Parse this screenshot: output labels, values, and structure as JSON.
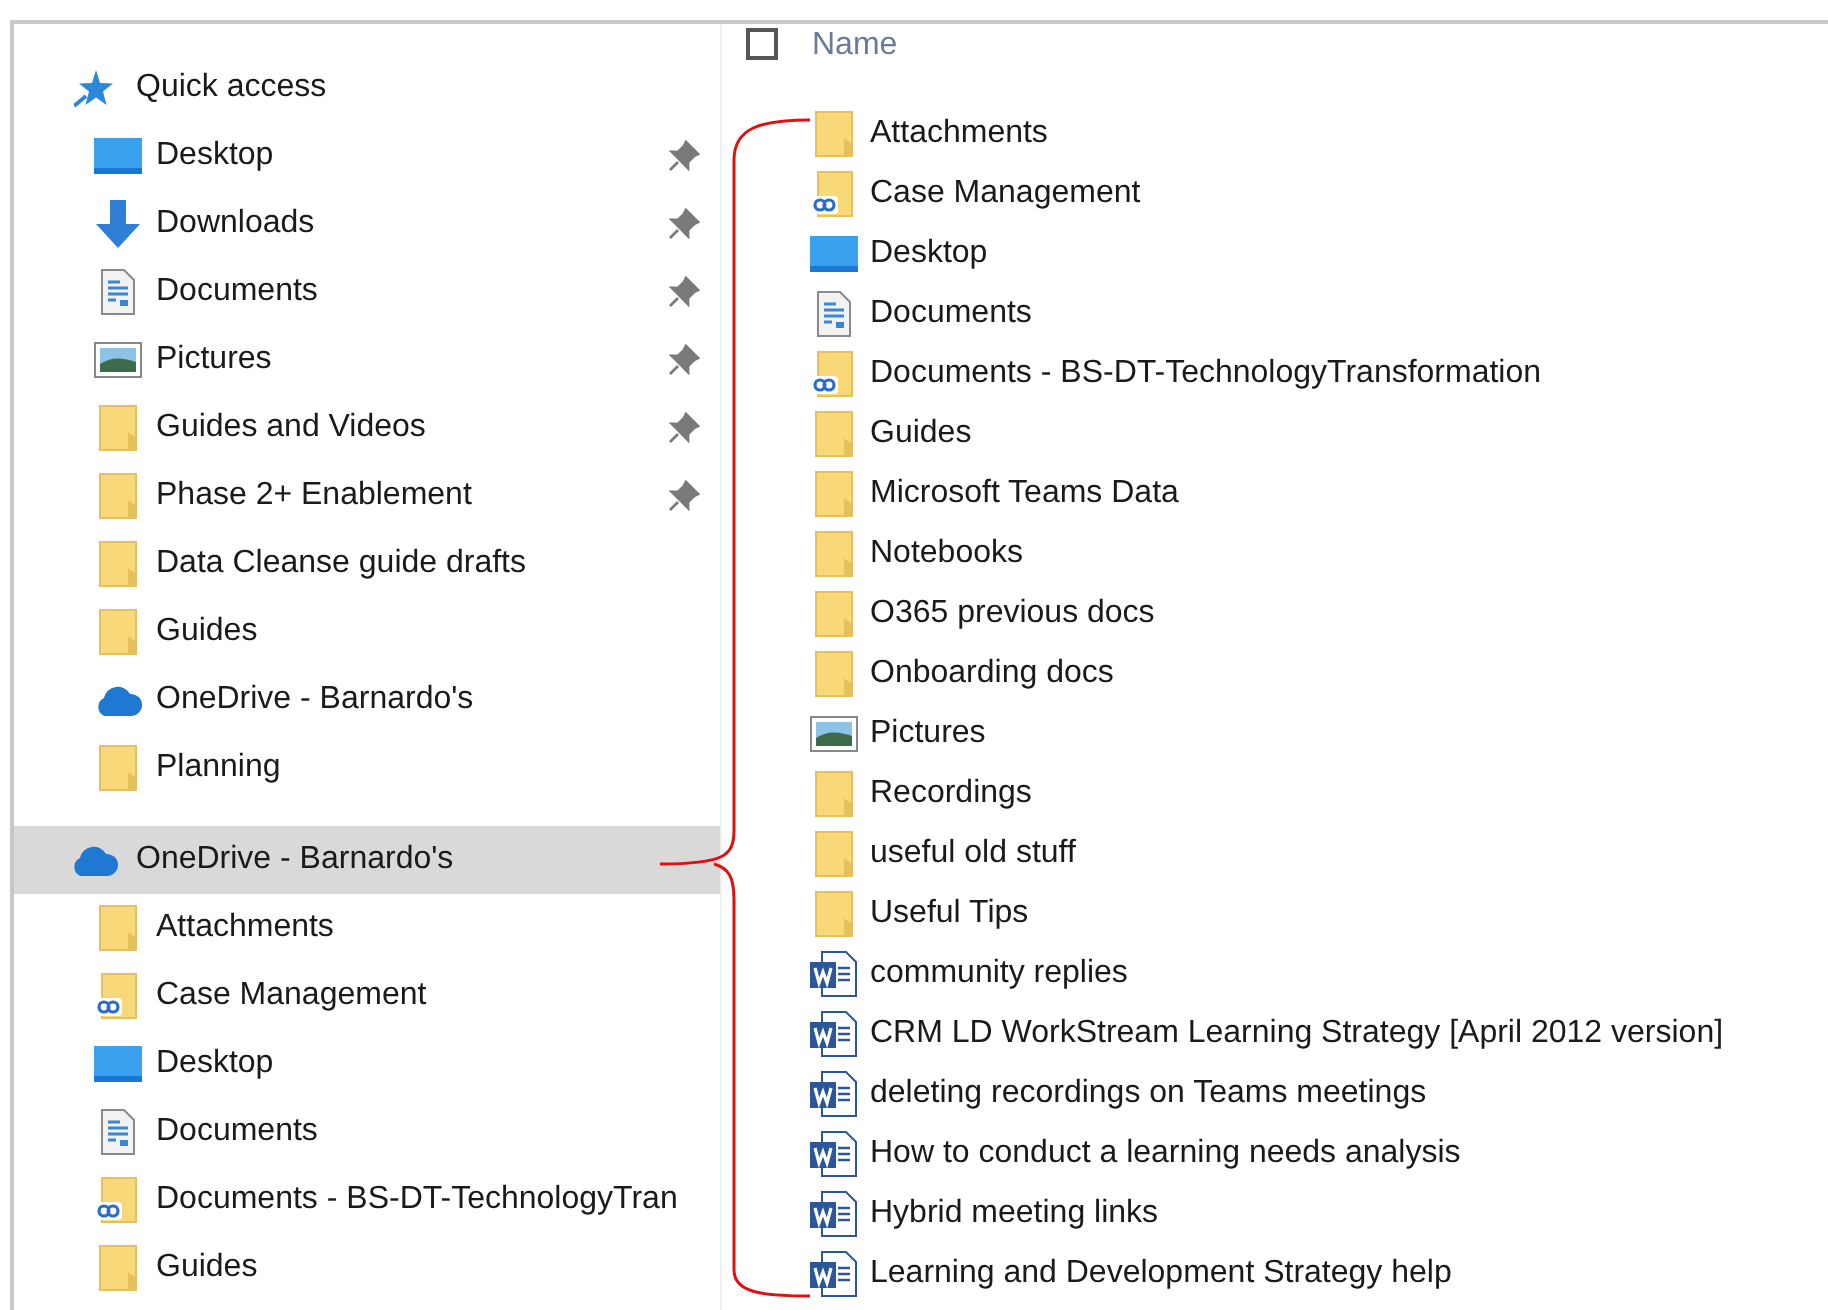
{
  "navigation_pane": {
    "sections": [
      {
        "label": "Quick access",
        "kind": "star",
        "selected": false,
        "items": [
          {
            "label": "Desktop",
            "kind": "desktop",
            "pinned": true
          },
          {
            "label": "Downloads",
            "kind": "download",
            "pinned": true
          },
          {
            "label": "Documents",
            "kind": "documents",
            "pinned": true
          },
          {
            "label": "Pictures",
            "kind": "pictures",
            "pinned": true
          },
          {
            "label": "Guides and Videos",
            "kind": "folder",
            "pinned": true
          },
          {
            "label": "Phase 2+ Enablement",
            "kind": "folder",
            "pinned": true
          },
          {
            "label": "Data Cleanse guide drafts",
            "kind": "folder",
            "pinned": false
          },
          {
            "label": "Guides",
            "kind": "folder",
            "pinned": false
          },
          {
            "label": "OneDrive - Barnardo's",
            "kind": "cloud",
            "pinned": false
          },
          {
            "label": "Planning",
            "kind": "folder",
            "pinned": false
          }
        ]
      },
      {
        "label": "OneDrive - Barnardo's",
        "kind": "cloud",
        "selected": true,
        "items": [
          {
            "label": "Attachments",
            "kind": "folder",
            "pinned": false
          },
          {
            "label": "Case Management",
            "kind": "linked",
            "pinned": false
          },
          {
            "label": "Desktop",
            "kind": "desktop",
            "pinned": false
          },
          {
            "label": "Documents",
            "kind": "documents",
            "pinned": false
          },
          {
            "label": "Documents - BS-DT-TechnologyTran",
            "kind": "linked",
            "pinned": false
          },
          {
            "label": "Guides",
            "kind": "folder",
            "pinned": false
          }
        ]
      }
    ]
  },
  "file_list": {
    "select_all_checked": false,
    "column_header": "Name",
    "items": [
      {
        "name": "Attachments",
        "kind": "folder"
      },
      {
        "name": "Case Management",
        "kind": "linked"
      },
      {
        "name": "Desktop",
        "kind": "desktop"
      },
      {
        "name": "Documents",
        "kind": "documents"
      },
      {
        "name": "Documents - BS-DT-TechnologyTransformation",
        "kind": "linked"
      },
      {
        "name": "Guides",
        "kind": "folder"
      },
      {
        "name": "Microsoft Teams Data",
        "kind": "folder"
      },
      {
        "name": "Notebooks",
        "kind": "folder"
      },
      {
        "name": "O365 previous docs",
        "kind": "folder"
      },
      {
        "name": "Onboarding docs",
        "kind": "folder"
      },
      {
        "name": "Pictures",
        "kind": "pictures"
      },
      {
        "name": "Recordings",
        "kind": "folder"
      },
      {
        "name": "useful old stuff",
        "kind": "folder"
      },
      {
        "name": "Useful Tips",
        "kind": "folder"
      },
      {
        "name": "community replies",
        "kind": "word"
      },
      {
        "name": "CRM LD WorkStream Learning Strategy [April 2012 version]",
        "kind": "word"
      },
      {
        "name": "deleting recordings on Teams meetings",
        "kind": "word"
      },
      {
        "name": "How to conduct a learning needs analysis",
        "kind": "word"
      },
      {
        "name": "Hybrid meeting links",
        "kind": "word"
      },
      {
        "name": "Learning and Development Strategy help",
        "kind": "word"
      }
    ]
  }
}
